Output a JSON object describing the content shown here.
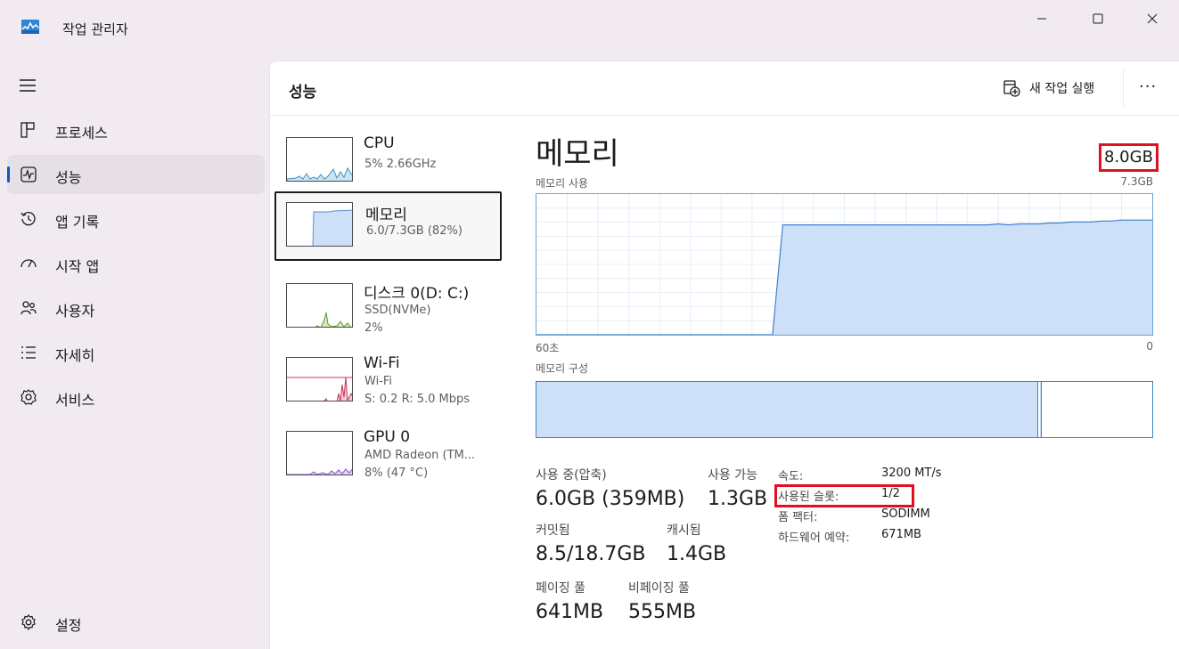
{
  "window": {
    "title": "작업 관리자",
    "minimize_icon": "minimize-icon",
    "maximize_icon": "maximize-icon",
    "close_icon": "close-icon"
  },
  "sidebar": {
    "items": [
      {
        "label": "프로세스",
        "icon": "processes-icon"
      },
      {
        "label": "성능",
        "icon": "performance-icon",
        "active": true
      },
      {
        "label": "앱 기록",
        "icon": "history-icon"
      },
      {
        "label": "시작 앱",
        "icon": "startup-icon"
      },
      {
        "label": "사용자",
        "icon": "users-icon"
      },
      {
        "label": "자세히",
        "icon": "details-icon"
      },
      {
        "label": "서비스",
        "icon": "services-icon"
      }
    ],
    "settings_label": "설정"
  },
  "header": {
    "title": "성능",
    "new_task_label": "새 작업 실행",
    "more_label": "···"
  },
  "perf_list": [
    {
      "name": "CPU",
      "sub1": "5% 2.66GHz",
      "sub2": "",
      "color": "#3c8fc4"
    },
    {
      "name": "메모리",
      "sub1": "6.0/7.3GB (82%)",
      "sub2": "",
      "color": "#5b8fd6",
      "selected": true
    },
    {
      "name": "디스크 0(D: C:)",
      "sub1": "SSD(NVMe)",
      "sub2": "2%",
      "color": "#5c9a2b"
    },
    {
      "name": "Wi-Fi",
      "sub1": "Wi-Fi",
      "sub2": "S: 0.2  R: 5.0 Mbps",
      "color": "#c8325a"
    },
    {
      "name": "GPU 0",
      "sub1": "AMD Radeon (TM...",
      "sub2": "8% (47 °C)",
      "color": "#8a4fd6"
    }
  ],
  "memory": {
    "title": "메모리",
    "total": "8.0GB",
    "usage_label": "메모리 사용",
    "usage_max": "7.3GB",
    "axis_left": "60초",
    "axis_right": "0",
    "composition_label": "메모리 구성",
    "stats": {
      "in_use_label": "사용 중(압축)",
      "in_use_value": "6.0GB (359MB)",
      "available_label": "사용 가능",
      "available_value": "1.3GB",
      "committed_label": "커밋됨",
      "committed_value": "8.5/18.7GB",
      "cached_label": "캐시됨",
      "cached_value": "1.4GB",
      "paged_label": "페이징 풀",
      "paged_value": "641MB",
      "nonpaged_label": "비페이징 풀",
      "nonpaged_value": "555MB"
    },
    "details": [
      {
        "key": "속도:",
        "value": "3200 MT/s"
      },
      {
        "key": "사용된 슬롯:",
        "value": "1/2"
      },
      {
        "key": "폼 팩터:",
        "value": "SODIMM"
      },
      {
        "key": "하드웨어 예약:",
        "value": "671MB"
      }
    ]
  },
  "chart_data": {
    "type": "area",
    "title": "메모리 사용",
    "xlabel": "",
    "ylabel": "",
    "x_range": [
      "60초",
      "0"
    ],
    "ylim": [
      0,
      7.3
    ],
    "grid": true,
    "series": [
      {
        "values": [
          0,
          0,
          0,
          0,
          0,
          0,
          0,
          0,
          0,
          0,
          0,
          0,
          0,
          0,
          0,
          0,
          0,
          0,
          0,
          0,
          0,
          0,
          0,
          0,
          5.7,
          5.7,
          5.7,
          5.7,
          5.7,
          5.7,
          5.7,
          5.7,
          5.7,
          5.7,
          5.7,
          5.7,
          5.7,
          5.7,
          5.7,
          5.7,
          5.7,
          5.7,
          5.7,
          5.7,
          5.7,
          5.75,
          5.7,
          5.75,
          5.75,
          5.75,
          5.8,
          5.8,
          5.85,
          5.85,
          5.85,
          5.9,
          5.9,
          5.95,
          5.95,
          5.95,
          5.95
        ]
      }
    ]
  }
}
